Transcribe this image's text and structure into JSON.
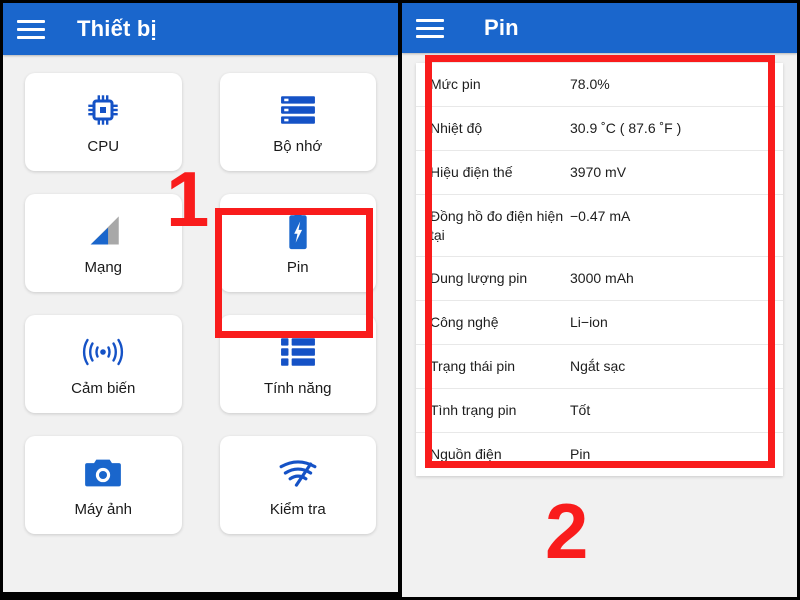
{
  "accent_blue": "#1a66cc",
  "annotation_red": "#f91c1c",
  "left_panel": {
    "appbar": {
      "title": "Thiết bị",
      "menu_icon": "hamburger-menu-icon"
    },
    "tiles": [
      {
        "label": "CPU",
        "icon": "cpu-chip-icon"
      },
      {
        "label": "Bộ nhớ",
        "icon": "memory-storage-icon"
      },
      {
        "label": "Mạng",
        "icon": "network-signal-icon"
      },
      {
        "label": "Pin",
        "icon": "battery-charging-icon"
      },
      {
        "label": "Cảm biến",
        "icon": "sensor-waves-icon"
      },
      {
        "label": "Tính năng",
        "icon": "feature-list-icon"
      },
      {
        "label": "Máy ảnh",
        "icon": "camera-icon"
      },
      {
        "label": "Kiểm tra",
        "icon": "wifi-speed-test-icon"
      }
    ]
  },
  "right_panel": {
    "appbar": {
      "title": "Pin",
      "menu_icon": "hamburger-menu-icon"
    },
    "battery_info": [
      {
        "key": "Mức pin",
        "value": "78.0%"
      },
      {
        "key": "Nhiệt độ",
        "value": "30.9 ˚C  ( 87.6 ˚F )"
      },
      {
        "key": "Hiệu điện thế",
        "value": "3970 mV"
      },
      {
        "key": "Đồng hồ đo điện hiện tại",
        "value": "−0.47 mA"
      },
      {
        "key": "Dung lượng pin",
        "value": "3000 mAh"
      },
      {
        "key": "Công nghệ",
        "value": "Li−ion"
      },
      {
        "key": "Trạng thái pin",
        "value": "Ngắt sạc"
      },
      {
        "key": "Tình trạng pin",
        "value": "Tốt"
      },
      {
        "key": "Nguồn điện",
        "value": "Pin"
      }
    ]
  },
  "annotations": [
    {
      "label": "1",
      "target": "Pin tile in device list"
    },
    {
      "label": "2",
      "target": "Battery info table"
    }
  ]
}
